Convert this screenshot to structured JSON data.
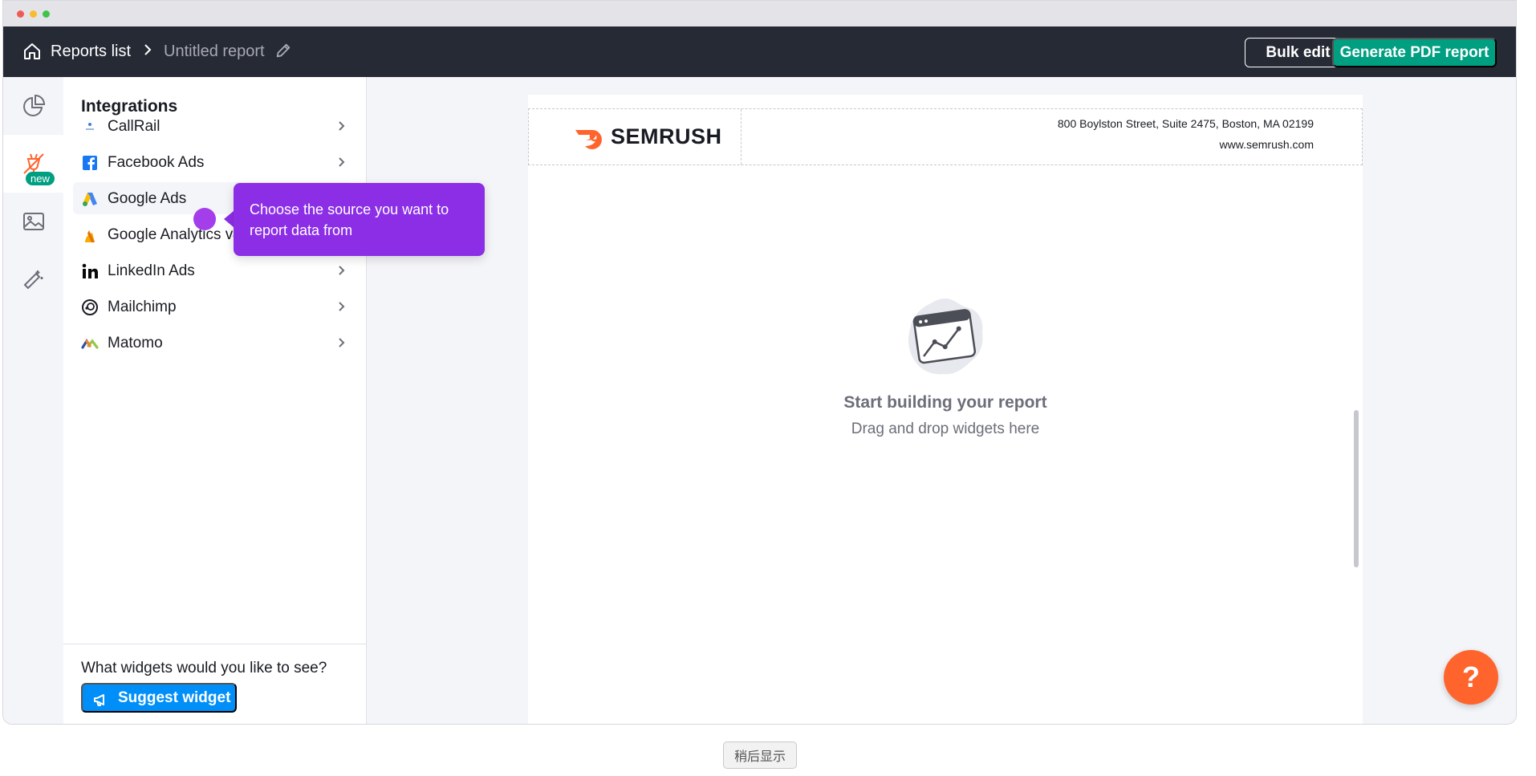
{
  "header": {
    "breadcrumb_home": "Reports list",
    "breadcrumb_current": "Untitled report",
    "bulk_edit_label": "Bulk edit",
    "generate_pdf_label": "Generate PDF report"
  },
  "rail": {
    "new_badge": "new"
  },
  "panel": {
    "title": "Integrations",
    "items": [
      {
        "label": "CallRail"
      },
      {
        "label": "Facebook Ads"
      },
      {
        "label": "Google Ads"
      },
      {
        "label": "Google Analytics v4"
      },
      {
        "label": "LinkedIn Ads"
      },
      {
        "label": "Mailchimp"
      },
      {
        "label": "Matomo"
      }
    ],
    "footer_question": "What widgets would you like to see?",
    "suggest_label": "Suggest widget"
  },
  "report": {
    "logo_text": "SEMRUSH",
    "address": "800 Boylston Street, Suite 2475, Boston, MA 02199",
    "website": "www.semrush.com",
    "empty_title": "Start building your report",
    "empty_subtitle": "Drag and drop widgets here"
  },
  "tooltip": {
    "text": "Choose the source you want to report data from"
  },
  "help": {
    "label": "?"
  },
  "later_button": "稍后显示",
  "colors": {
    "header_bg": "#262a35",
    "primary_green": "#009f81",
    "primary_blue": "#008ff8",
    "tooltip_purple": "#8b2ee6",
    "help_orange": "#ff642d"
  }
}
